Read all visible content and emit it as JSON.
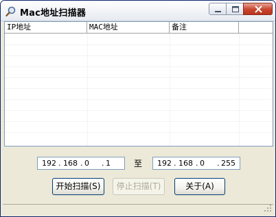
{
  "window": {
    "title": "Mac地址扫描器",
    "icon": "magnifier-icon"
  },
  "title_buttons": {
    "minimize": "minimize-icon",
    "maximize": "maximize-icon",
    "close": "close-icon"
  },
  "list": {
    "columns": [
      "IP地址",
      "MAC地址",
      "备注"
    ],
    "rows": []
  },
  "range": {
    "start": [
      "192",
      "168",
      "0",
      "1"
    ],
    "end": [
      "192",
      "168",
      "0",
      "255"
    ],
    "separator": "至"
  },
  "buttons": {
    "start_scan": "开始扫描(S)",
    "stop_scan": "停止扫描(T)",
    "about": "关于(A)"
  },
  "status": {
    "text": ""
  },
  "colors": {
    "titlebar": "#f4f6f9",
    "window_bg": "#ece9d8",
    "close_button": "#c9442d",
    "border": "#7f9db9"
  }
}
